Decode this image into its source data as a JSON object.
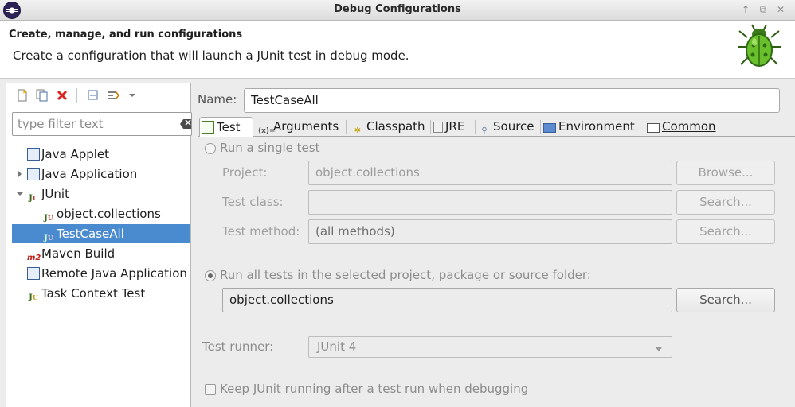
{
  "window": {
    "title": "Debug Configurations"
  },
  "banner": {
    "heading": "Create, manage, and run configurations",
    "description": "Create a configuration that will launch a JUnit test in debug mode."
  },
  "left": {
    "filter_placeholder": "type filter text",
    "tree": [
      {
        "label": "Java Applet",
        "icon": "java-applet-icon"
      },
      {
        "label": "Java Application",
        "icon": "java-application-icon"
      },
      {
        "label": "JUnit",
        "icon": "junit-icon"
      },
      {
        "label": "object.collections",
        "icon": "junit-icon"
      },
      {
        "label": "TestCaseAll",
        "icon": "junit-test-icon",
        "selected": true
      },
      {
        "label": "Maven Build",
        "icon": "maven-icon"
      },
      {
        "label": "Remote Java Application",
        "icon": "remote-java-icon"
      },
      {
        "label": "Task Context Test",
        "icon": "task-context-icon"
      }
    ]
  },
  "main": {
    "name_label": "Name:",
    "name_value": "TestCaseAll",
    "tabs": [
      {
        "label": "Test"
      },
      {
        "label": "Arguments"
      },
      {
        "label": "Classpath"
      },
      {
        "label": "JRE"
      },
      {
        "label": "Source"
      },
      {
        "label": "Environment"
      },
      {
        "label": "Common"
      }
    ],
    "test": {
      "single_label": "Run a single test",
      "project_label": "Project:",
      "project_value": "object.collections",
      "browse_label": "Browse...",
      "class_label": "Test class:",
      "class_value": "",
      "search_label": "Search...",
      "method_label": "Test method:",
      "method_value": "(all methods)",
      "all_label": "Run all tests in the selected project, package or source folder:",
      "container_value": "object.collections",
      "runner_label": "Test runner:",
      "runner_value": "JUnit 4",
      "keep_label": "Keep JUnit running after a test run when debugging"
    }
  }
}
